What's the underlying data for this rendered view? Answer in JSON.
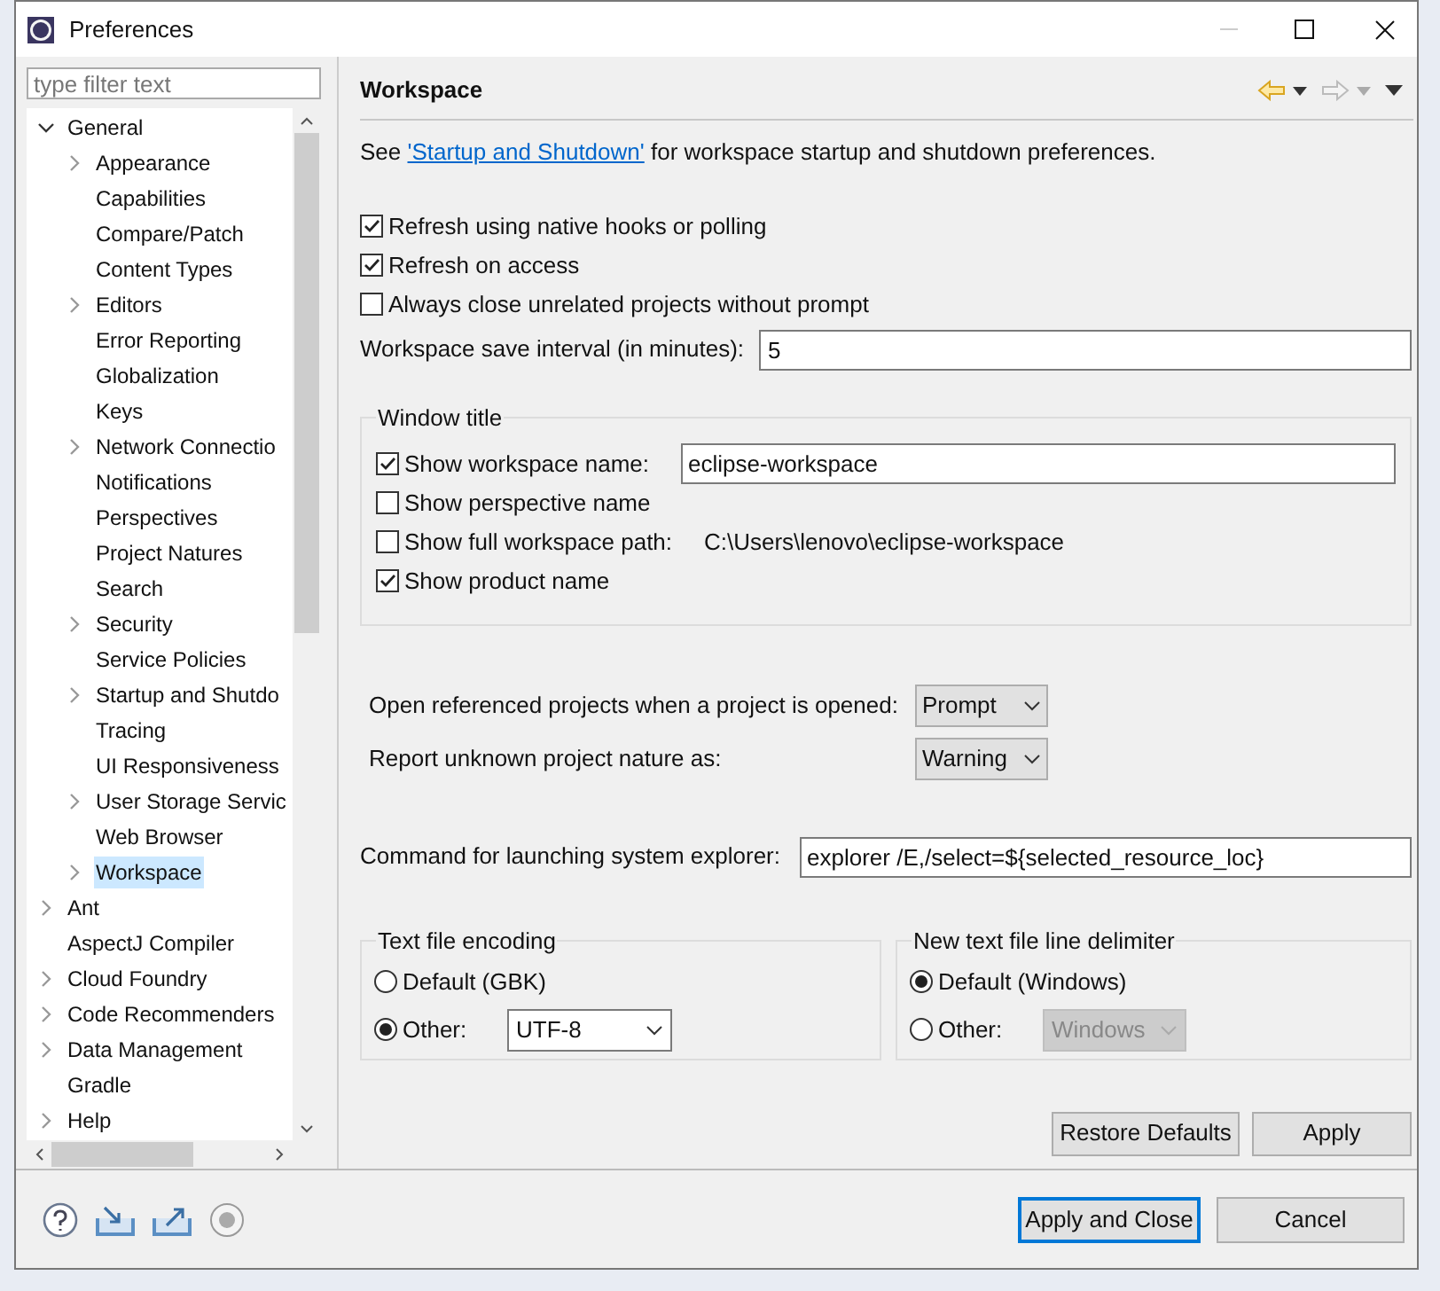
{
  "window": {
    "title": "Preferences"
  },
  "filter": {
    "placeholder": "type filter text"
  },
  "tree": [
    {
      "label": "General",
      "kind": "folder",
      "expanded": true,
      "selected": false,
      "children": [
        {
          "label": "Appearance",
          "kind": "folder",
          "expanded": false,
          "selected": false
        },
        {
          "label": "Capabilities",
          "kind": "leaf",
          "selected": false
        },
        {
          "label": "Compare/Patch",
          "kind": "leaf",
          "selected": false
        },
        {
          "label": "Content Types",
          "kind": "leaf",
          "selected": false
        },
        {
          "label": "Editors",
          "kind": "folder",
          "expanded": false,
          "selected": false
        },
        {
          "label": "Error Reporting",
          "kind": "leaf",
          "selected": false
        },
        {
          "label": "Globalization",
          "kind": "leaf",
          "selected": false
        },
        {
          "label": "Keys",
          "kind": "leaf",
          "selected": false
        },
        {
          "label": "Network Connectio",
          "kind": "folder",
          "expanded": false,
          "selected": false
        },
        {
          "label": "Notifications",
          "kind": "leaf",
          "selected": false
        },
        {
          "label": "Perspectives",
          "kind": "leaf",
          "selected": false
        },
        {
          "label": "Project Natures",
          "kind": "leaf",
          "selected": false
        },
        {
          "label": "Search",
          "kind": "leaf",
          "selected": false
        },
        {
          "label": "Security",
          "kind": "folder",
          "expanded": false,
          "selected": false
        },
        {
          "label": "Service Policies",
          "kind": "leaf",
          "selected": false
        },
        {
          "label": "Startup and Shutdo",
          "kind": "folder",
          "expanded": false,
          "selected": false
        },
        {
          "label": "Tracing",
          "kind": "leaf",
          "selected": false
        },
        {
          "label": "UI Responsiveness",
          "kind": "leaf",
          "selected": false
        },
        {
          "label": "User Storage Servic",
          "kind": "folder",
          "expanded": false,
          "selected": false
        },
        {
          "label": "Web Browser",
          "kind": "leaf",
          "selected": false
        },
        {
          "label": "Workspace",
          "kind": "folder",
          "expanded": false,
          "selected": true
        }
      ]
    },
    {
      "label": "Ant",
      "kind": "folder",
      "expanded": false,
      "selected": false
    },
    {
      "label": "AspectJ Compiler",
      "kind": "leaf",
      "selected": false
    },
    {
      "label": "Cloud Foundry",
      "kind": "folder",
      "expanded": false,
      "selected": false
    },
    {
      "label": "Code Recommenders",
      "kind": "folder",
      "expanded": false,
      "selected": false
    },
    {
      "label": "Data Management",
      "kind": "folder",
      "expanded": false,
      "selected": false
    },
    {
      "label": "Gradle",
      "kind": "leaf",
      "selected": false
    },
    {
      "label": "Help",
      "kind": "folder",
      "expanded": false,
      "selected": false
    }
  ],
  "page": {
    "title": "Workspace",
    "intro": {
      "before": "See ",
      "link": "'Startup and Shutdown'",
      "after": " for workspace startup and shutdown preferences."
    },
    "options": [
      {
        "label": "Refresh using native hooks or polling",
        "checked": true
      },
      {
        "label": "Refresh on access",
        "checked": true
      },
      {
        "label": "Always close unrelated projects without prompt",
        "checked": false
      }
    ],
    "save_interval": {
      "label": "Workspace save interval (in minutes):",
      "value": "5"
    },
    "window_title": {
      "title": "Window title",
      "options": [
        {
          "kind": "field",
          "label": "Show workspace name:",
          "checked": true,
          "value": "eclipse-workspace"
        },
        {
          "kind": "plain",
          "label": "Show perspective name",
          "checked": false
        },
        {
          "kind": "path",
          "label": "Show full workspace path:",
          "checked": false,
          "value": "C:\\Users\\lenovo\\eclipse-workspace"
        },
        {
          "kind": "plain",
          "label": "Show product name",
          "checked": true
        }
      ]
    },
    "selects": [
      {
        "label": "Open referenced projects when a project is opened:",
        "value": "Prompt"
      },
      {
        "label": "Report unknown project nature as:",
        "value": "Warning"
      }
    ],
    "explorer": {
      "label": "Command for launching system explorer:",
      "value": "explorer /E,/select=${selected_resource_loc}"
    },
    "groups": [
      {
        "title": "Text file encoding",
        "options": [
          {
            "kind": "plain",
            "label": "Default (GBK)",
            "selected": false
          },
          {
            "kind": "select",
            "label": "Other:",
            "selected": true,
            "value": "UTF-8",
            "disabled": false
          }
        ]
      },
      {
        "title": "New text file line delimiter",
        "options": [
          {
            "kind": "plain",
            "label": "Default (Windows)",
            "selected": true
          },
          {
            "kind": "select",
            "label": "Other:",
            "selected": false,
            "value": "Windows",
            "disabled": true
          }
        ]
      }
    ],
    "buttons": [
      "Restore Defaults",
      "Apply"
    ]
  },
  "dialog_buttons": [
    {
      "label": "Apply and Close",
      "focused": true
    },
    {
      "label": "Cancel",
      "focused": false
    }
  ]
}
